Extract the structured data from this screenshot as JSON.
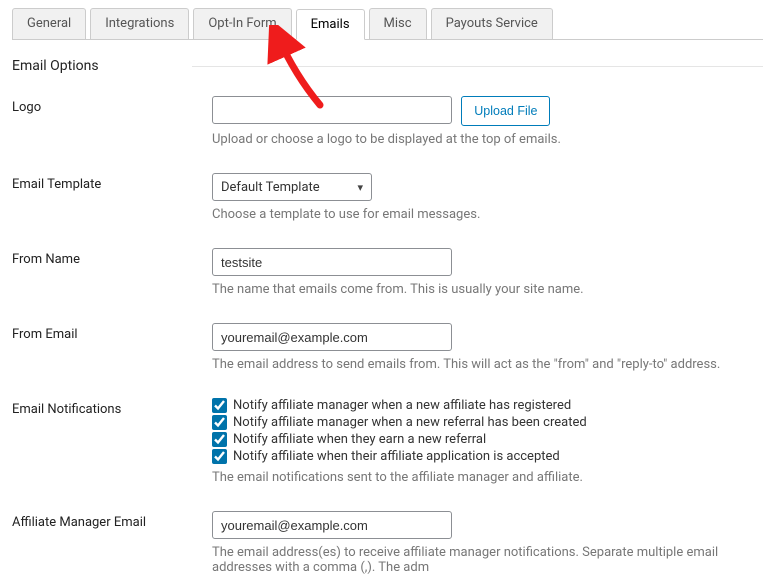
{
  "tabs": {
    "general": "General",
    "integrations": "Integrations",
    "optin": "Opt-In Form",
    "emails": "Emails",
    "misc": "Misc",
    "payouts": "Payouts Service"
  },
  "section_title": "Email Options",
  "logo": {
    "label": "Logo",
    "value": "",
    "button": "Upload File",
    "help": "Upload or choose a logo to be displayed at the top of emails."
  },
  "template": {
    "label": "Email Template",
    "value": "Default Template",
    "help": "Choose a template to use for email messages."
  },
  "from_name": {
    "label": "From Name",
    "value": "testsite",
    "help": "The name that emails come from. This is usually your site name."
  },
  "from_email": {
    "label": "From Email",
    "value": "youremail@example.com",
    "help": "The email address to send emails from. This will act as the \"from\" and \"reply-to\" address."
  },
  "notifications": {
    "label": "Email Notifications",
    "opt1": "Notify affiliate manager when a new affiliate has registered",
    "opt2": "Notify affiliate manager when a new referral has been created",
    "opt3": "Notify affiliate when they earn a new referral",
    "opt4": "Notify affiliate when their affiliate application is accepted",
    "help": "The email notifications sent to the affiliate manager and affiliate."
  },
  "manager_email": {
    "label": "Affiliate Manager Email",
    "value": "youremail@example.com",
    "help": "The email address(es) to receive affiliate manager notifications. Separate multiple email addresses with a comma (,). The adm"
  }
}
